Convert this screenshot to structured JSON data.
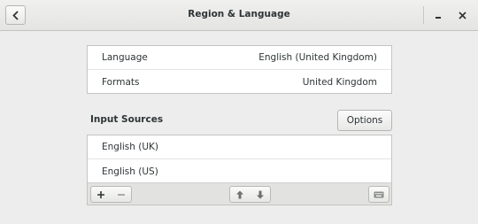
{
  "header": {
    "title": "Region & Language",
    "back_icon": "chevron-left-icon",
    "minimize_icon": "minimize-icon",
    "close_icon": "close-icon"
  },
  "language_settings": [
    {
      "label": "Language",
      "value": "English (United Kingdom)"
    },
    {
      "label": "Formats",
      "value": "United Kingdom"
    }
  ],
  "input_sources": {
    "title": "Input Sources",
    "options_label": "Options",
    "items": [
      "English (UK)",
      "English (US)"
    ],
    "toolbar": {
      "add_icon": "plus-icon",
      "remove_icon": "minus-icon",
      "move_up_icon": "arrow-up-icon",
      "move_down_icon": "arrow-down-icon",
      "keyboard_icon": "keyboard-icon"
    }
  }
}
